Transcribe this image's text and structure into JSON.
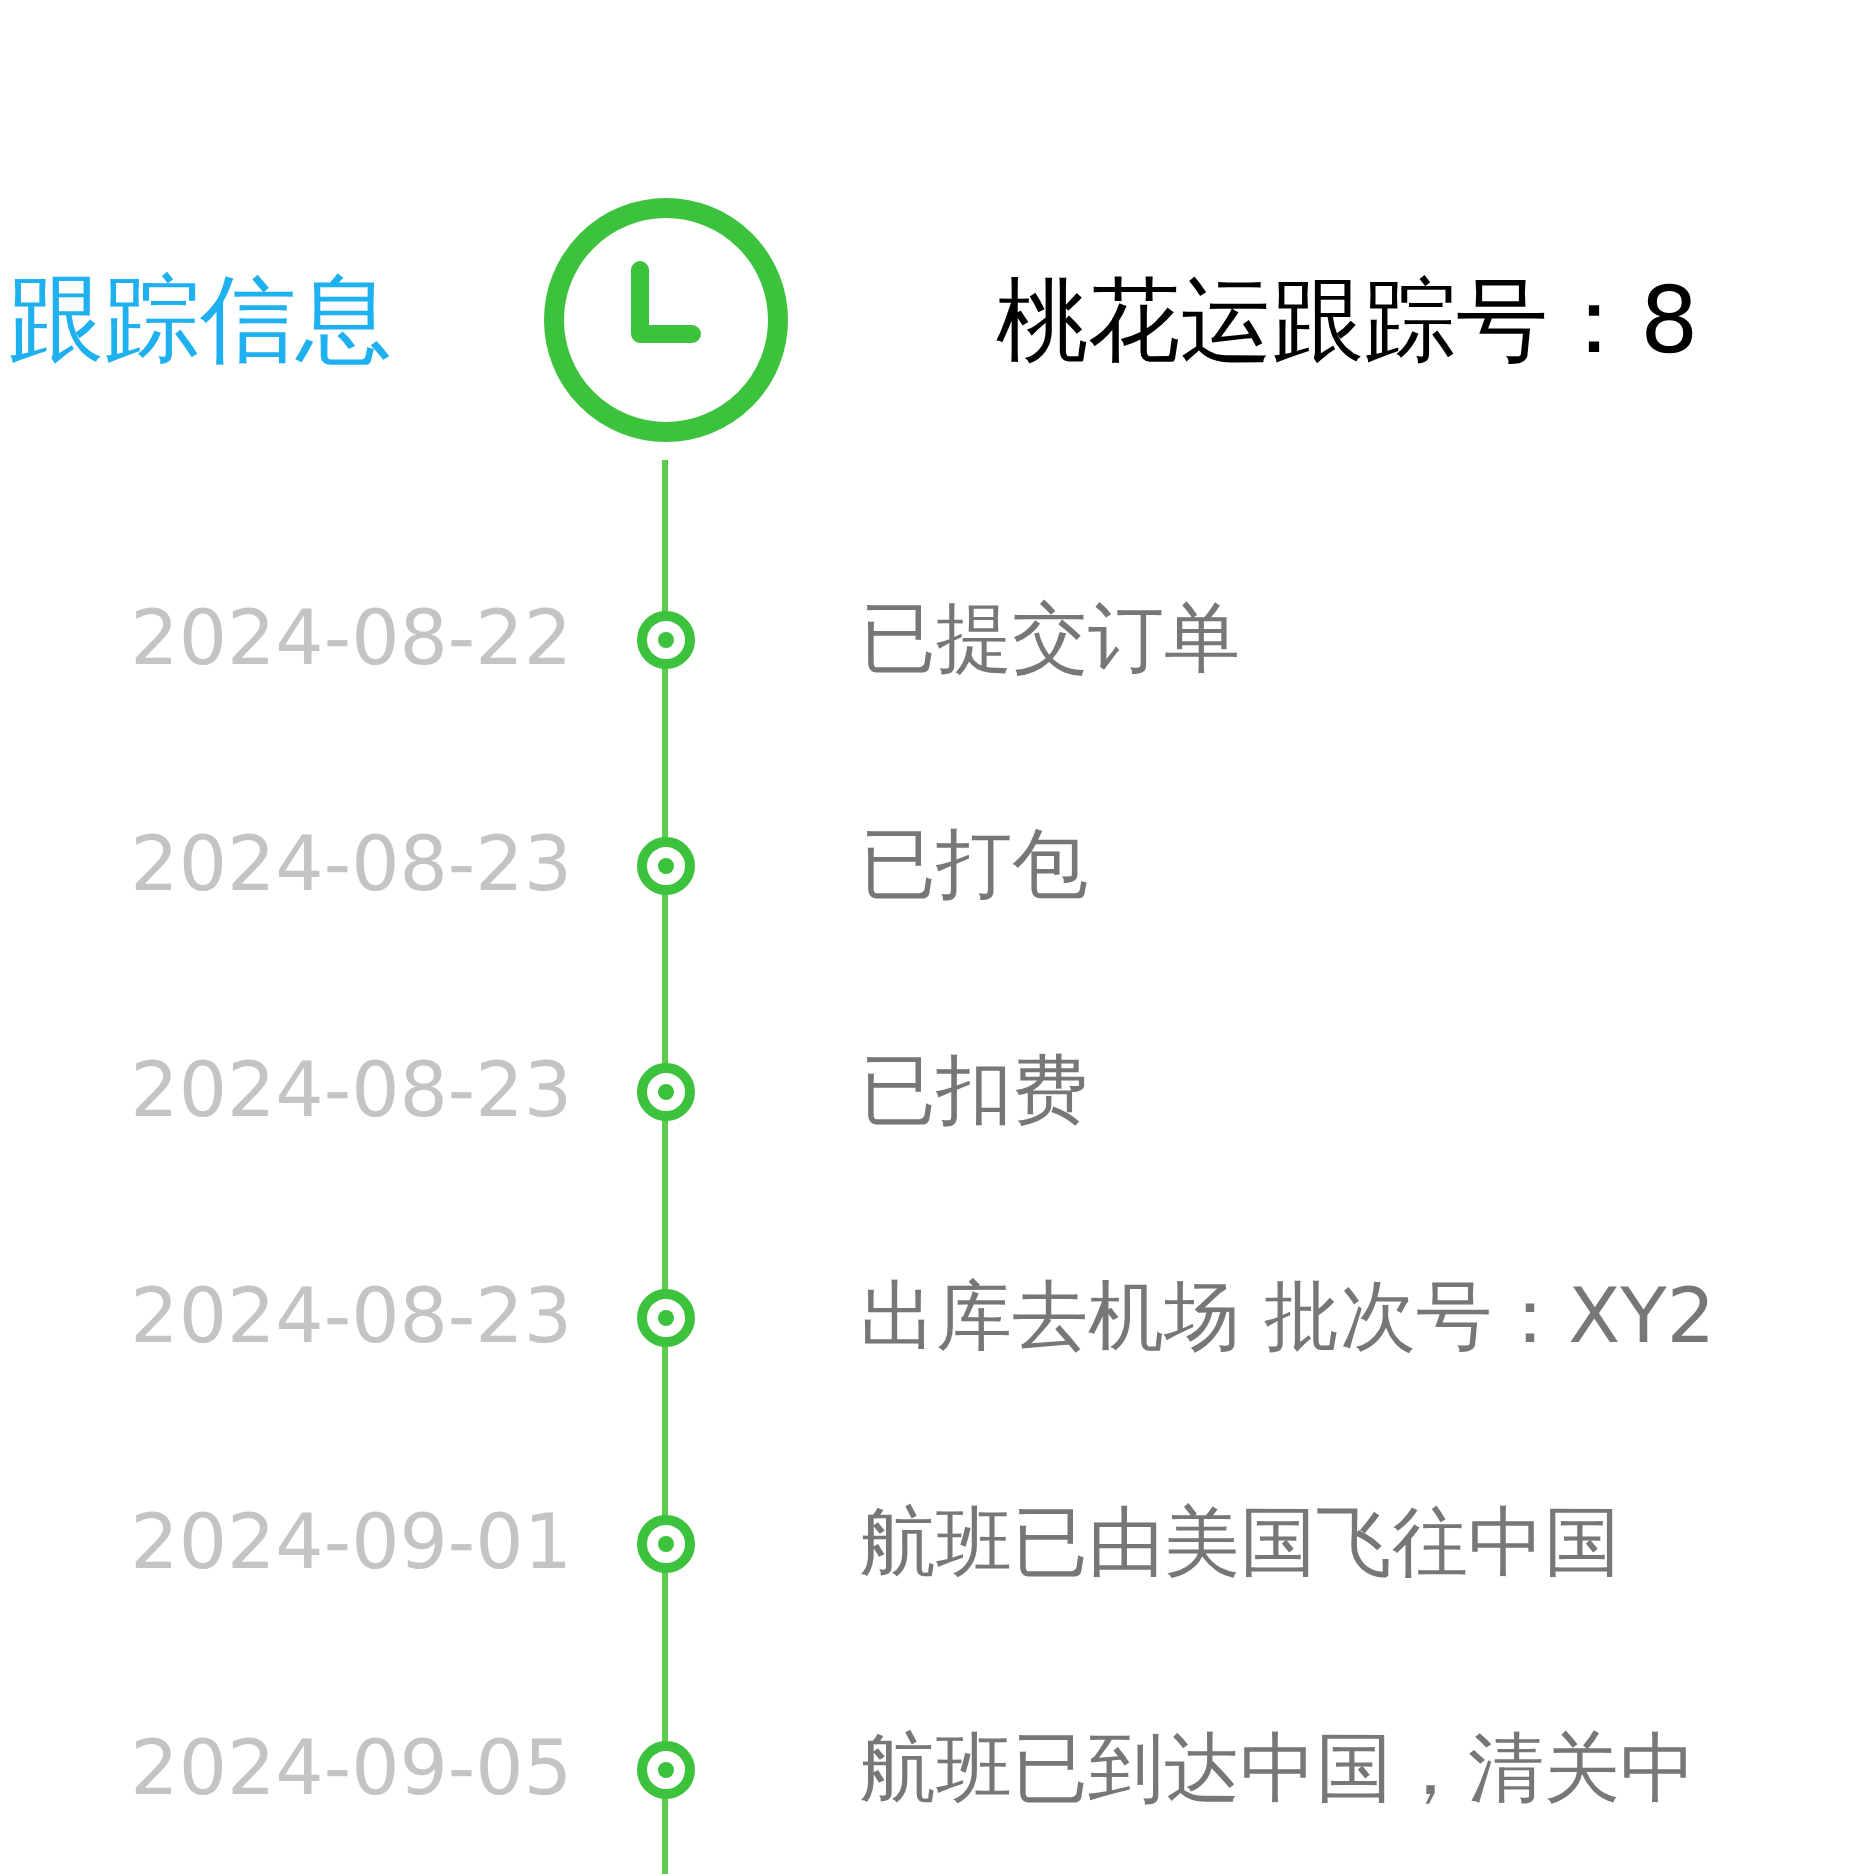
{
  "header": {
    "title": "跟踪信息",
    "tracking_label": "桃花运跟踪号：8"
  },
  "events": [
    {
      "date": "2024-08-22",
      "status": "已提交订单"
    },
    {
      "date": "2024-08-23",
      "status": "已打包"
    },
    {
      "date": "2024-08-23",
      "status": "已扣费"
    },
    {
      "date": "2024-08-23",
      "status": "出库去机场 批次号：XY2"
    },
    {
      "date": "2024-09-01",
      "status": "航班已由美国飞往中国"
    },
    {
      "date": "2024-09-05",
      "status": "航班已到达中国，清关中"
    }
  ]
}
